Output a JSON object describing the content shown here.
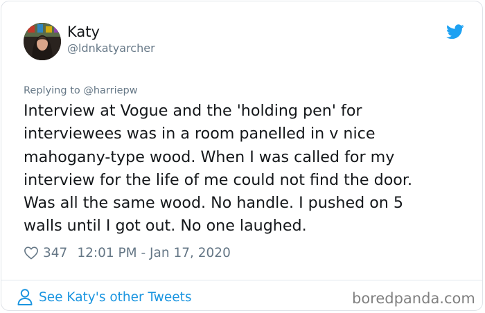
{
  "tweet": {
    "display_name": "Katy",
    "handle": "@ldnkatyarcher",
    "replying_to": "Replying to @harriepw",
    "text_lines": [
      "Interview at Vogue and the 'holding pen' for",
      "interviewees was in a room panelled in v nice",
      "mahogany-type wood. When I was called for my",
      "interview for the life of me could not find the door.",
      "Was all the same wood. No handle. I pushed on 5",
      "walls until I got out. No one laughed."
    ],
    "like_count": "347",
    "timestamp": "12:01 PM - Jan 17, 2020"
  },
  "footer": {
    "see_more_label": "See Katy's other Tweets",
    "watermark": "boredpanda.com"
  },
  "icons": {
    "brand": "twitter-bird-icon",
    "like": "heart-icon",
    "profile": "person-icon"
  },
  "colors": {
    "twitter_blue": "#1da1f2",
    "link_blue": "#1b95e0",
    "text_primary": "#14171a",
    "text_secondary": "#657786"
  }
}
